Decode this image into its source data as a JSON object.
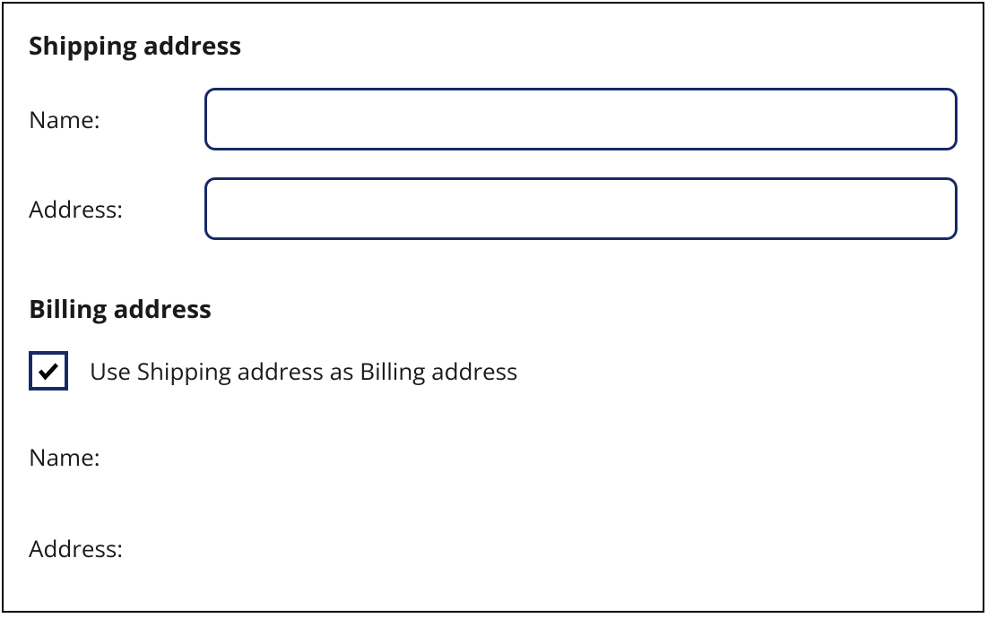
{
  "shipping": {
    "heading": "Shipping address",
    "name_label": "Name:",
    "name_value": "",
    "address_label": "Address:",
    "address_value": ""
  },
  "billing": {
    "heading": "Billing address",
    "checkbox_label": "Use Shipping address as Billing address",
    "checkbox_checked": true,
    "name_label": "Name:",
    "address_label": "Address:"
  }
}
